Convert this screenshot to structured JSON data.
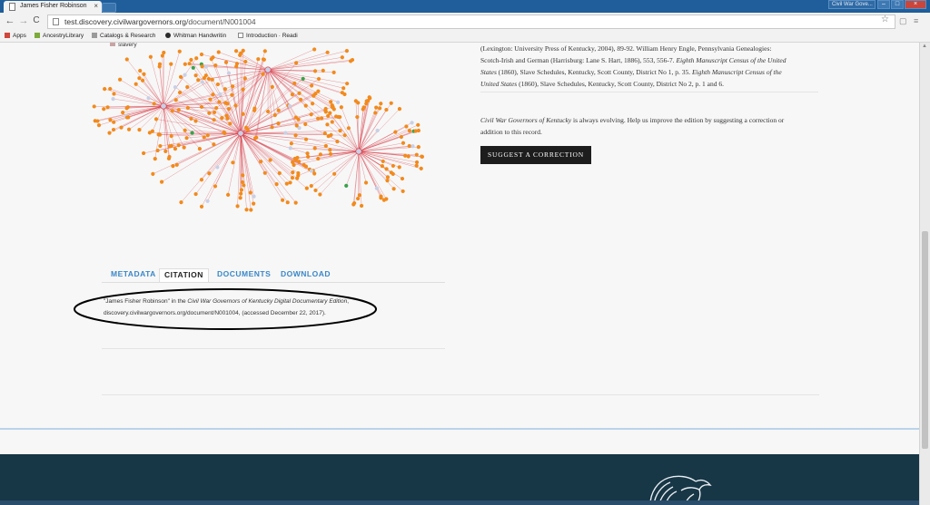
{
  "browser": {
    "tab_title": "James Fisher Robinson",
    "tab_close": "×",
    "window_label": "Civil War Gove...",
    "url_host": "test.discovery.civilwargovernors.org",
    "url_path": "/document/N001004",
    "back": "←",
    "forward": "→",
    "reload": "C",
    "star": "☆",
    "bookmarks": [
      {
        "label": "Apps",
        "color": "#d0463a"
      },
      {
        "label": "AncestryLibrary",
        "color": "#7cab3a"
      },
      {
        "label": "Catalogs & Research",
        "color": "#9a9a9a"
      },
      {
        "label": "Whitman Handwritin",
        "color": "#2b2b2b"
      },
      {
        "label": "Introduction · Readi",
        "color": "#ffffff"
      }
    ]
  },
  "graph": {
    "legend_label": "slavery",
    "colors": {
      "edge": "#d7343f",
      "node": "#f28a1c",
      "hub": "#c8d0e6",
      "green": "#3aa14a"
    }
  },
  "tabs": {
    "metadata": "METADATA",
    "citation": "CITATION",
    "documents": "DOCUMENTS",
    "download": "DOWNLOAD"
  },
  "citation": {
    "part1": "\"James Fisher Robinson\" in the ",
    "edition": "Civil War Governors of Kentucky Digital Documentary Edition",
    "part2": ",",
    "line2": "discovery.civilwargovernors.org/document/N001004, (accessed December 22, 2017)."
  },
  "sources": {
    "l1": "(Lexington: University Press of Kentucky, 2004), 89-92. William Henry Engle, Pennsylvania Genealogies:",
    "l2a": "Scotch-Irish and German (Harrisburg: Lane S. Hart, 1886), 553, 556-7. ",
    "l2b": "Eighth Manuscript Census of the United",
    "l3a": "States",
    "l3b": " (1860), Slave Schedules, Kentucky, Scott County, District No 1, p. 35. ",
    "l3c": "Eighth Manuscript Census of the",
    "l4a": "United States",
    "l4b": " (1860), Slave Schedules, Kentucky, Scott County, District No 2, p. 1 and 6."
  },
  "evolving": {
    "title": "Civil War Governors of Kentucky",
    "rest": " is always evolving. Help us improve the edition by suggesting a correction or",
    "line2": "addition to this record."
  },
  "suggest_button": "SUGGEST A CORRECTION"
}
